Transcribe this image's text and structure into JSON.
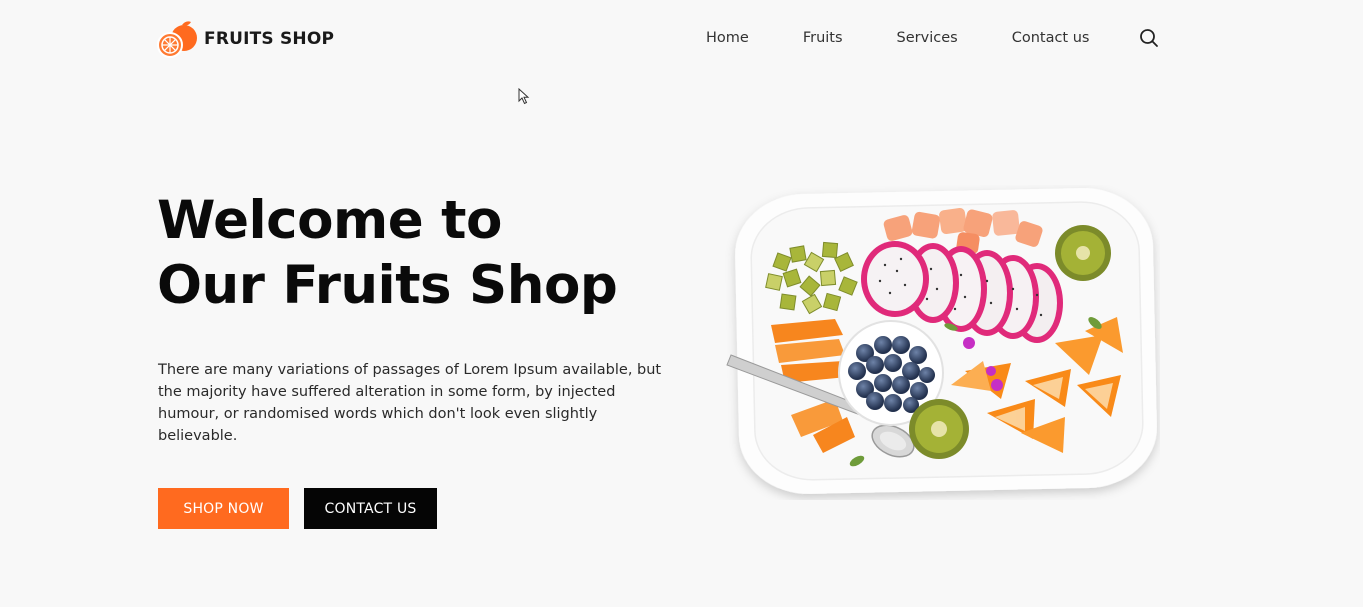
{
  "header": {
    "brand": "FRUITS SHOP",
    "logo_icon": "orange-logo-icon",
    "nav": [
      "Home",
      "Fruits",
      "Services",
      "Contact us"
    ],
    "search_icon": "search-icon"
  },
  "hero": {
    "title_line1": "Welcome to",
    "title_line2": "Our Fruits Shop",
    "description": "There are many variations of passages of Lorem Ipsum available, but the majority have suffered alteration in some form, by injected humour, or randomised words which don't look even slightly believable.",
    "shop_button": "SHOP NOW",
    "contact_button": "CONTACT US",
    "image": "fruit-platter-image"
  },
  "colors": {
    "accent": "#ff6a1f",
    "dark": "#050505",
    "background": "#f8f8f8"
  }
}
